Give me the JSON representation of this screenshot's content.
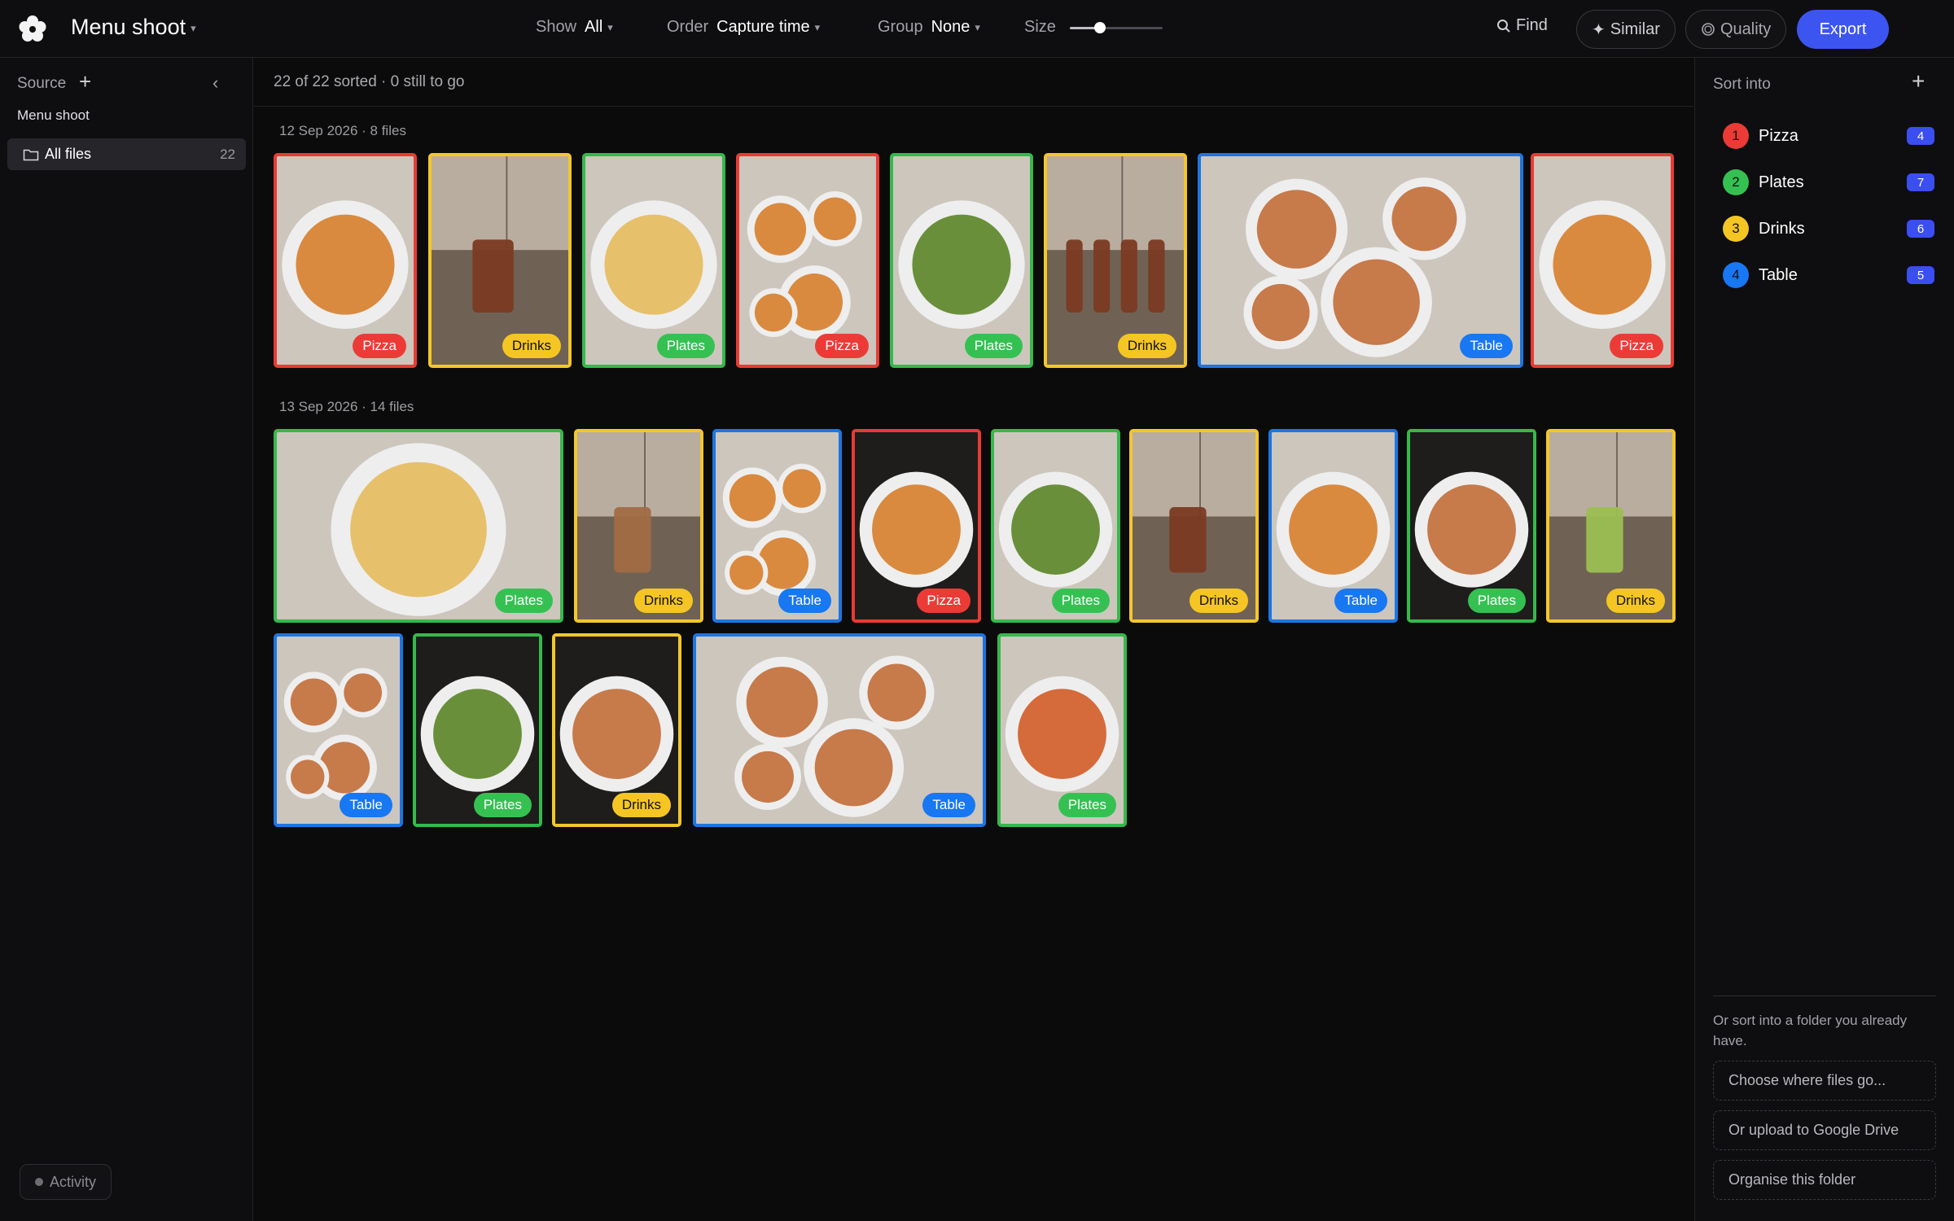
{
  "app": {
    "title": "Menu shoot",
    "logo_icon": "flower-logo-icon"
  },
  "toolbar": {
    "show_label": "Show",
    "show_value": "All",
    "order_label": "Order",
    "order_value": "Capture time",
    "group_label": "Group",
    "group_value": "None",
    "size_label": "Size",
    "size_level": 0.32,
    "find_label": "Find",
    "similar_label": "Similar",
    "quality_label": "Quality",
    "export_label": "Export"
  },
  "sidebar": {
    "source_label": "Source",
    "group_name": "Menu shoot",
    "items": [
      {
        "label": "All files",
        "count": "22"
      }
    ],
    "activity_label": "Activity"
  },
  "main": {
    "status": "22 of 22 sorted · 0 still to go",
    "groups": [
      {
        "label": "12 Sep 2026 · 8 files"
      },
      {
        "label": "13 Sep 2026 · 14 files"
      }
    ],
    "photos": [
      {
        "tag": "Pizza",
        "color": "#e93b33",
        "subject": "pizza-plate"
      },
      {
        "tag": "Drinks",
        "color": "#f3c72b",
        "subject": "iced-tea-glass"
      },
      {
        "tag": "Plates",
        "color": "#35b94c",
        "subject": "fusilli-pasta"
      },
      {
        "tag": "Pizza",
        "color": "#e93b33",
        "subject": "pizzas-spread"
      },
      {
        "tag": "Plates",
        "color": "#35b94c",
        "subject": "salad-bowl"
      },
      {
        "tag": "Drinks",
        "color": "#f3c72b",
        "subject": "drinks-row"
      },
      {
        "tag": "Table",
        "color": "#1d76e2",
        "subject": "table-spread"
      },
      {
        "tag": "Pizza",
        "color": "#e93b33",
        "subject": "white-pizza"
      },
      {
        "tag": "Plates",
        "color": "#35b94c",
        "subject": "carbonara"
      },
      {
        "tag": "Drinks",
        "color": "#f3c72b",
        "subject": "milkshake"
      },
      {
        "tag": "Table",
        "color": "#1d76e2",
        "subject": "pizza-with-bowls"
      },
      {
        "tag": "Pizza",
        "color": "#e93b33",
        "subject": "pizza-on-rack"
      },
      {
        "tag": "Plates",
        "color": "#35b94c",
        "subject": "green-salad"
      },
      {
        "tag": "Drinks",
        "color": "#f3c72b",
        "subject": "orange-juice"
      },
      {
        "tag": "Table",
        "color": "#1d76e2",
        "subject": "pizza-and-side"
      },
      {
        "tag": "Plates",
        "color": "#35b94c",
        "subject": "tacos-plate"
      },
      {
        "tag": "Drinks",
        "color": "#f3c72b",
        "subject": "mojito"
      },
      {
        "tag": "Table",
        "color": "#1d76e2",
        "subject": "bowls-table"
      },
      {
        "tag": "Plates",
        "color": "#35b94c",
        "subject": "fries-salad"
      },
      {
        "tag": "Drinks",
        "color": "#f3c72b",
        "subject": "chocolate-dessert-drink"
      },
      {
        "tag": "Table",
        "color": "#1d76e2",
        "subject": "full-table"
      },
      {
        "tag": "Plates",
        "color": "#35b94c",
        "subject": "fruit-tart"
      }
    ]
  },
  "sort_panel": {
    "title": "Sort into",
    "categories": [
      {
        "num": "1",
        "name": "Pizza",
        "count": "4",
        "color": "#ec3b36",
        "numColor": "#111"
      },
      {
        "num": "2",
        "name": "Plates",
        "count": "7",
        "color": "#35c152",
        "numColor": "#111"
      },
      {
        "num": "3",
        "name": "Drinks",
        "count": "6",
        "color": "#f5c623",
        "numColor": "#111"
      },
      {
        "num": "4",
        "name": "Table",
        "count": "5",
        "color": "#1877f2",
        "numColor": "#111"
      }
    ],
    "hint": "Or sort into a folder you already have.",
    "choose_label": "Choose where files go...",
    "drive_label": "Or upload to Google Drive",
    "organise_label": "Organise this folder"
  }
}
